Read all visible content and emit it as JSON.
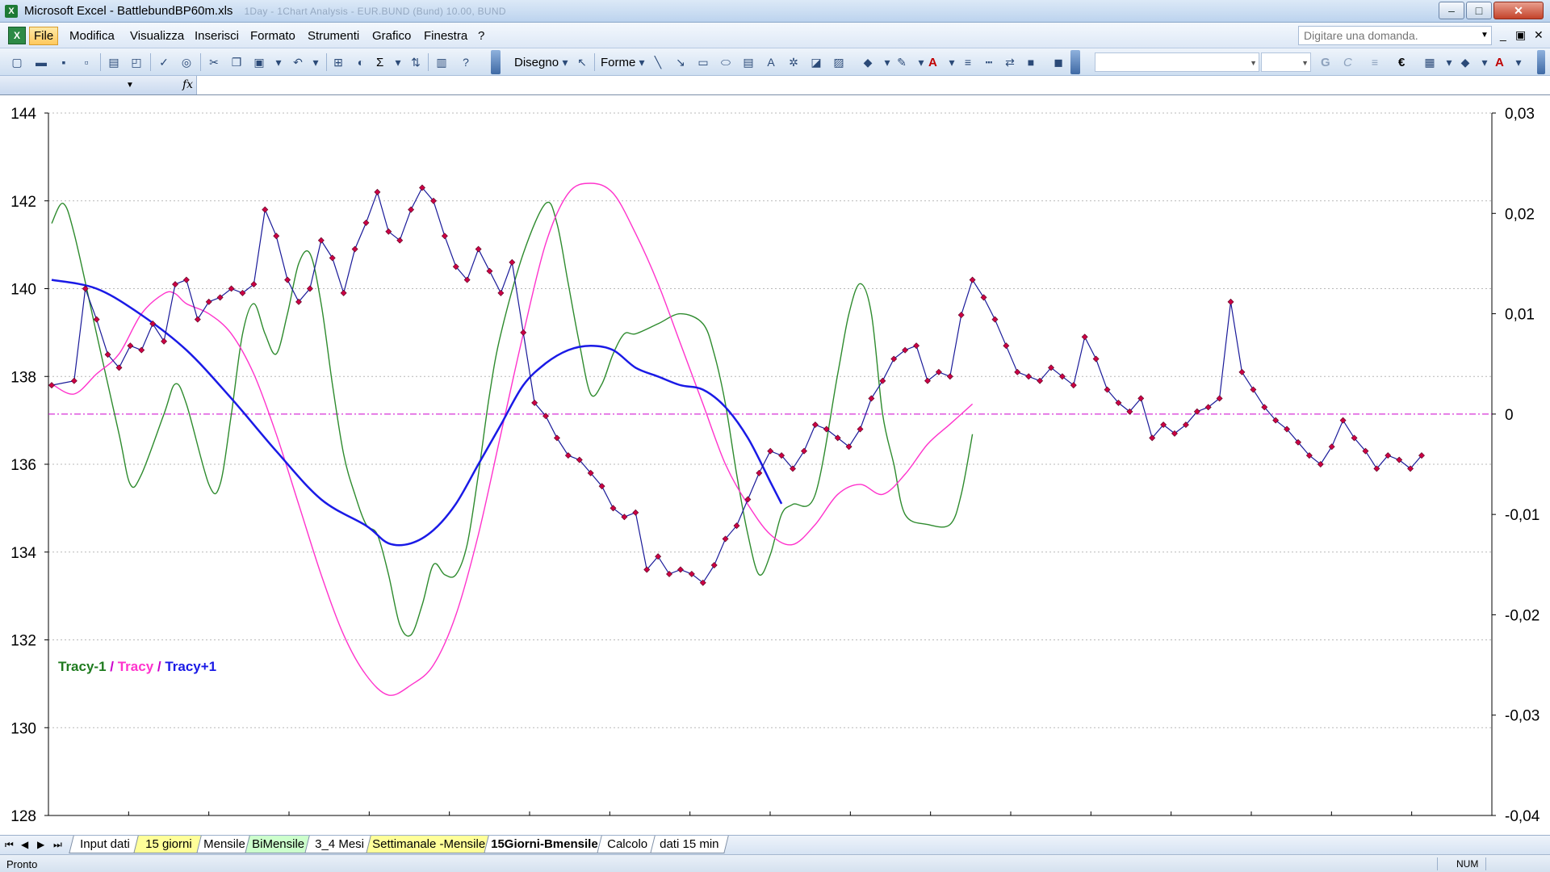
{
  "window": {
    "title": "Microsoft Excel - BattlebundBP60m.xls",
    "title_extra": "1Day - 1Chart Analysis - EUR.BUND (Bund) 10.00, BUND",
    "minimize": "–",
    "maximize": "□",
    "close": "✕"
  },
  "menu": {
    "items": [
      "File",
      "Modifica",
      "Visualizza",
      "Inserisci",
      "Formato",
      "Strumenti",
      "Grafico",
      "Finestra",
      "?"
    ],
    "help_placeholder": "Digitare una domanda.",
    "doc_minimize": "_",
    "doc_restore": "▣",
    "doc_close": "✕"
  },
  "toolbar": {
    "draw_label": "Disegno",
    "shapes_label": "Forme",
    "sum_symbol": "Σ",
    "bold_label": "G",
    "italic_label": "C",
    "euro_symbol": "€",
    "font_color_label": "A",
    "icons": [
      "new-icon",
      "open-icon",
      "save-icon",
      "permission-icon",
      "print-icon",
      "print-preview-icon",
      "spelling-icon",
      "research-icon",
      "cut-icon",
      "copy-icon",
      "paste-icon",
      "undo-icon",
      "chart-wizard-icon",
      "autosum-icon",
      "sort-icon",
      "chart-icon",
      "help-icon",
      "pointer-icon",
      "line-icon",
      "arrow-icon",
      "rectangle-icon",
      "oval-icon",
      "textbox-icon",
      "wordart-icon",
      "diagram-icon",
      "clipart-icon",
      "picture-icon",
      "fill-color-icon",
      "line-color-icon",
      "font-color-icon",
      "line-style-icon",
      "dash-style-icon",
      "arrow-style-icon",
      "shadow-icon",
      "3d-icon",
      "align-icon",
      "borders-icon"
    ]
  },
  "formula_bar": {
    "fx": "fx"
  },
  "chart_data": {
    "type": "line",
    "title": "",
    "legend": {
      "placement": "left",
      "entries": [
        {
          "label": "Tracy-1",
          "color": "#1e7b1e"
        },
        {
          "label": "Tracy",
          "color": "#ff33cc"
        },
        {
          "label": "Tracy+1",
          "color": "#1a1ae6"
        }
      ],
      "separator": " / "
    },
    "y_left": {
      "min": 128,
      "max": 144,
      "ticks": [
        "128",
        "130",
        "132",
        "134",
        "136",
        "138",
        "140",
        "142",
        "144"
      ]
    },
    "y_right": {
      "min": -0.04,
      "max": 0.03,
      "ticks": [
        "-0,04",
        "-0,03",
        "-0,02",
        "-0,01",
        "0",
        "0,01",
        "0,02",
        "0,03"
      ]
    },
    "gridlines": true,
    "zero_line": {
      "axis": "right",
      "value": 0,
      "color": "#cc00cc"
    },
    "x_count": 18,
    "series": [
      {
        "name": "Price",
        "axis": "left",
        "color": "#1a1a99",
        "marker_color": "#cc0044",
        "values": [
          [
            0,
            137.8
          ],
          [
            1,
            137.9
          ],
          [
            1.5,
            140.0
          ],
          [
            2,
            139.3
          ],
          [
            2.5,
            138.5
          ],
          [
            3,
            138.2
          ],
          [
            3.5,
            138.7
          ],
          [
            4,
            138.6
          ],
          [
            4.5,
            139.2
          ],
          [
            5,
            138.8
          ],
          [
            5.5,
            140.1
          ],
          [
            6,
            140.2
          ],
          [
            6.5,
            139.3
          ],
          [
            7,
            139.7
          ],
          [
            7.5,
            139.8
          ],
          [
            8,
            140.0
          ],
          [
            8.5,
            139.9
          ],
          [
            9,
            140.1
          ],
          [
            9.5,
            141.8
          ],
          [
            10,
            141.2
          ],
          [
            10.5,
            140.2
          ],
          [
            11,
            139.7
          ],
          [
            11.5,
            140.0
          ],
          [
            12,
            141.1
          ],
          [
            12.5,
            140.7
          ],
          [
            13,
            139.9
          ],
          [
            13.5,
            140.9
          ],
          [
            14,
            141.5
          ],
          [
            14.5,
            142.2
          ],
          [
            15,
            141.3
          ],
          [
            15.5,
            141.1
          ],
          [
            16,
            141.8
          ],
          [
            16.5,
            142.3
          ],
          [
            17,
            142.0
          ],
          [
            17.5,
            141.2
          ],
          [
            18,
            140.5
          ],
          [
            18.5,
            140.2
          ],
          [
            19,
            140.9
          ],
          [
            19.5,
            140.4
          ],
          [
            20,
            139.9
          ],
          [
            20.5,
            140.6
          ],
          [
            21,
            139.0
          ],
          [
            21.5,
            137.4
          ],
          [
            22,
            137.1
          ],
          [
            22.5,
            136.6
          ],
          [
            23,
            136.2
          ],
          [
            23.5,
            136.1
          ],
          [
            24,
            135.8
          ],
          [
            24.5,
            135.5
          ],
          [
            25,
            135.0
          ],
          [
            25.5,
            134.8
          ],
          [
            26,
            134.9
          ],
          [
            26.5,
            133.6
          ],
          [
            27,
            133.9
          ],
          [
            27.5,
            133.5
          ],
          [
            28,
            133.6
          ],
          [
            28.5,
            133.5
          ],
          [
            29,
            133.3
          ],
          [
            29.5,
            133.7
          ],
          [
            30,
            134.3
          ],
          [
            30.5,
            134.6
          ],
          [
            31,
            135.2
          ],
          [
            31.5,
            135.8
          ],
          [
            32,
            136.3
          ],
          [
            32.5,
            136.2
          ],
          [
            33,
            135.9
          ],
          [
            33.5,
            136.3
          ],
          [
            34,
            136.9
          ],
          [
            34.5,
            136.8
          ],
          [
            35,
            136.6
          ],
          [
            35.5,
            136.4
          ],
          [
            36,
            136.8
          ],
          [
            36.5,
            137.5
          ],
          [
            37,
            137.9
          ],
          [
            37.5,
            138.4
          ],
          [
            38,
            138.6
          ],
          [
            38.5,
            138.7
          ],
          [
            39,
            137.9
          ],
          [
            39.5,
            138.1
          ],
          [
            40,
            138.0
          ],
          [
            40.5,
            139.4
          ],
          [
            41,
            140.2
          ],
          [
            41.5,
            139.8
          ],
          [
            42,
            139.3
          ],
          [
            42.5,
            138.7
          ],
          [
            43,
            138.1
          ],
          [
            43.5,
            138.0
          ],
          [
            44,
            137.9
          ],
          [
            44.5,
            138.2
          ],
          [
            45,
            138.0
          ],
          [
            45.5,
            137.8
          ],
          [
            46,
            138.9
          ],
          [
            46.5,
            138.4
          ],
          [
            47,
            137.7
          ],
          [
            47.5,
            137.4
          ],
          [
            48,
            137.2
          ],
          [
            48.5,
            137.5
          ],
          [
            49,
            136.6
          ],
          [
            49.5,
            136.9
          ],
          [
            50,
            136.7
          ],
          [
            50.5,
            136.9
          ],
          [
            51,
            137.2
          ],
          [
            51.5,
            137.3
          ],
          [
            52,
            137.5
          ],
          [
            52.5,
            139.7
          ],
          [
            53,
            138.1
          ],
          [
            53.5,
            137.7
          ],
          [
            54,
            137.3
          ],
          [
            54.5,
            137.0
          ],
          [
            55,
            136.8
          ],
          [
            55.5,
            136.5
          ],
          [
            56,
            136.2
          ],
          [
            56.5,
            136.0
          ],
          [
            57,
            136.4
          ],
          [
            57.5,
            137.0
          ],
          [
            58,
            136.6
          ],
          [
            58.5,
            136.3
          ],
          [
            59,
            135.9
          ],
          [
            59.5,
            136.2
          ],
          [
            60,
            136.1
          ],
          [
            60.5,
            135.9
          ],
          [
            61,
            136.2
          ]
        ]
      },
      {
        "name": "Tracy-1",
        "axis": "right",
        "color": "#2e8b2e",
        "values": [
          [
            0,
            0.019
          ],
          [
            0.5,
            0.021
          ],
          [
            1,
            0.018
          ],
          [
            2,
            0.008
          ],
          [
            3,
            -0.002
          ],
          [
            3.5,
            -0.007
          ],
          [
            4,
            -0.006
          ],
          [
            5,
            0.0
          ],
          [
            5.5,
            0.003
          ],
          [
            6,
            0.001
          ],
          [
            7,
            -0.007
          ],
          [
            7.5,
            -0.007
          ],
          [
            8,
            0.0
          ],
          [
            8.5,
            0.008
          ],
          [
            9,
            0.011
          ],
          [
            9.5,
            0.008
          ],
          [
            10,
            0.006
          ],
          [
            10.5,
            0.01
          ],
          [
            11,
            0.015
          ],
          [
            11.5,
            0.016
          ],
          [
            12,
            0.011
          ],
          [
            12.5,
            0.003
          ],
          [
            13,
            -0.004
          ],
          [
            13.5,
            -0.008
          ],
          [
            14,
            -0.011
          ],
          [
            14.5,
            -0.012
          ],
          [
            15,
            -0.016
          ],
          [
            15.5,
            -0.021
          ],
          [
            16,
            -0.022
          ],
          [
            16.5,
            -0.019
          ],
          [
            17,
            -0.015
          ],
          [
            17.5,
            -0.016
          ],
          [
            18,
            -0.016
          ],
          [
            18.5,
            -0.013
          ],
          [
            19,
            -0.006
          ],
          [
            19.5,
            0.002
          ],
          [
            20,
            0.008
          ],
          [
            21,
            0.016
          ],
          [
            22,
            0.021
          ],
          [
            22.5,
            0.019
          ],
          [
            23,
            0.013
          ],
          [
            23.5,
            0.007
          ],
          [
            24,
            0.002
          ],
          [
            24.5,
            0.003
          ],
          [
            25,
            0.006
          ],
          [
            25.5,
            0.008
          ],
          [
            26,
            0.008
          ],
          [
            27,
            0.009
          ],
          [
            28,
            0.01
          ],
          [
            29,
            0.009
          ],
          [
            29.5,
            0.006
          ],
          [
            30,
            0.001
          ],
          [
            30.5,
            -0.006
          ],
          [
            31,
            -0.012
          ],
          [
            31.5,
            -0.016
          ],
          [
            32,
            -0.014
          ],
          [
            32.5,
            -0.01
          ],
          [
            33,
            -0.009
          ],
          [
            34,
            -0.008
          ],
          [
            35,
            0.004
          ],
          [
            35.5,
            0.01
          ],
          [
            36,
            0.013
          ],
          [
            36.5,
            0.01
          ],
          [
            37,
            0.0
          ],
          [
            37.5,
            -0.005
          ],
          [
            38,
            -0.01
          ],
          [
            39,
            -0.011
          ],
          [
            40,
            -0.011
          ],
          [
            40.5,
            -0.008
          ],
          [
            41,
            -0.002
          ]
        ]
      },
      {
        "name": "Tracy",
        "axis": "right",
        "color": "#ff33cc",
        "values": [
          [
            0,
            0.003
          ],
          [
            1,
            0.002
          ],
          [
            2,
            0.004
          ],
          [
            3,
            0.006
          ],
          [
            4,
            0.01
          ],
          [
            5,
            0.012
          ],
          [
            5.5,
            0.012
          ],
          [
            6,
            0.011
          ],
          [
            7,
            0.01
          ],
          [
            8,
            0.008
          ],
          [
            9,
            0.004
          ],
          [
            10,
            -0.002
          ],
          [
            11,
            -0.009
          ],
          [
            12,
            -0.016
          ],
          [
            13,
            -0.022
          ],
          [
            14,
            -0.026
          ],
          [
            15,
            -0.028
          ],
          [
            16,
            -0.027
          ],
          [
            17,
            -0.025
          ],
          [
            18,
            -0.02
          ],
          [
            19,
            -0.012
          ],
          [
            20,
            -0.002
          ],
          [
            21,
            0.008
          ],
          [
            22,
            0.017
          ],
          [
            23,
            0.022
          ],
          [
            24,
            0.023
          ],
          [
            25,
            0.022
          ],
          [
            26,
            0.018
          ],
          [
            27,
            0.013
          ],
          [
            28,
            0.007
          ],
          [
            29,
            0.001
          ],
          [
            30,
            -0.005
          ],
          [
            31,
            -0.009
          ],
          [
            32,
            -0.012
          ],
          [
            33,
            -0.013
          ],
          [
            34,
            -0.011
          ],
          [
            35,
            -0.008
          ],
          [
            36,
            -0.007
          ],
          [
            37,
            -0.008
          ],
          [
            38,
            -0.006
          ],
          [
            39,
            -0.003
          ],
          [
            40,
            -0.001
          ],
          [
            41,
            0.001
          ]
        ]
      },
      {
        "name": "Tracy+1",
        "axis": "left",
        "color": "#1a1ae6",
        "values": [
          [
            0,
            140.2
          ],
          [
            2,
            140.0
          ],
          [
            4,
            139.4
          ],
          [
            6,
            138.6
          ],
          [
            8,
            137.5
          ],
          [
            10,
            136.3
          ],
          [
            12,
            135.2
          ],
          [
            14,
            134.6
          ],
          [
            15,
            134.2
          ],
          [
            16,
            134.2
          ],
          [
            17,
            134.5
          ],
          [
            18,
            135.1
          ],
          [
            19,
            136.0
          ],
          [
            20,
            136.9
          ],
          [
            21,
            137.8
          ],
          [
            22,
            138.3
          ],
          [
            23,
            138.6
          ],
          [
            24,
            138.7
          ],
          [
            25,
            138.6
          ],
          [
            26,
            138.2
          ],
          [
            27,
            138.0
          ],
          [
            28,
            137.8
          ],
          [
            29,
            137.7
          ],
          [
            30,
            137.3
          ],
          [
            31,
            136.6
          ],
          [
            32,
            135.6
          ],
          [
            32.5,
            135.1
          ]
        ]
      }
    ]
  },
  "sheet_tabs": [
    {
      "label": "Input dati",
      "color": "#ffffff"
    },
    {
      "label": "15 giorni",
      "color": "#ffff99"
    },
    {
      "label": "Mensile",
      "color": "#ffffff"
    },
    {
      "label": "BiMensile",
      "color": "#ccffcc"
    },
    {
      "label": "3_4 Mesi",
      "color": "#ffffff"
    },
    {
      "label": "Settimanale -Mensile",
      "color": "#ffff99"
    },
    {
      "label": "15Giorni-Bmensile",
      "color": "#ffffff",
      "active": true
    },
    {
      "label": "Calcolo",
      "color": "#ffffff"
    },
    {
      "label": "dati 15 min",
      "color": "#ffffff"
    }
  ],
  "tab_nav": [
    "⏮",
    "◀",
    "▶",
    "⏭"
  ],
  "status": {
    "ready": "Pronto",
    "num": "NUM"
  }
}
